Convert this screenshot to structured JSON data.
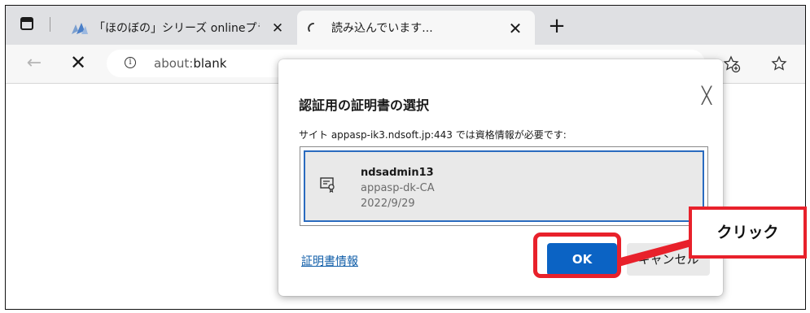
{
  "browser": {
    "tabs": [
      {
        "label": "「ほのぼの」シリーズ onlineプラットフォ",
        "close": "✕",
        "active": false
      },
      {
        "label": "読み込んでいます...",
        "close": "✕",
        "active": true
      }
    ],
    "new_tab": "+",
    "nav_back": "←",
    "nav_stop": "✕",
    "address": {
      "scheme": "about:",
      "path": "blank"
    },
    "info_glyph": "i"
  },
  "dialog": {
    "title": "認証用の証明書の選択",
    "close": "╳",
    "subtitle": "サイト appasp-ik3.ndsoft.jp:443 では資格情報が必要です:",
    "certificates": [
      {
        "name": "ndsadmin13",
        "issuer": "appasp-dk-CA",
        "date": "2022/9/29"
      }
    ],
    "cert_info_link": "証明書情報",
    "ok_label": "OK",
    "cancel_label": "キャンセル"
  },
  "annotation": {
    "callout_text": "クリック",
    "color": "#e8212b"
  },
  "colors": {
    "accent": "#0b63c4",
    "link": "#0f5da8",
    "selection_border": "#2a6bbf"
  }
}
